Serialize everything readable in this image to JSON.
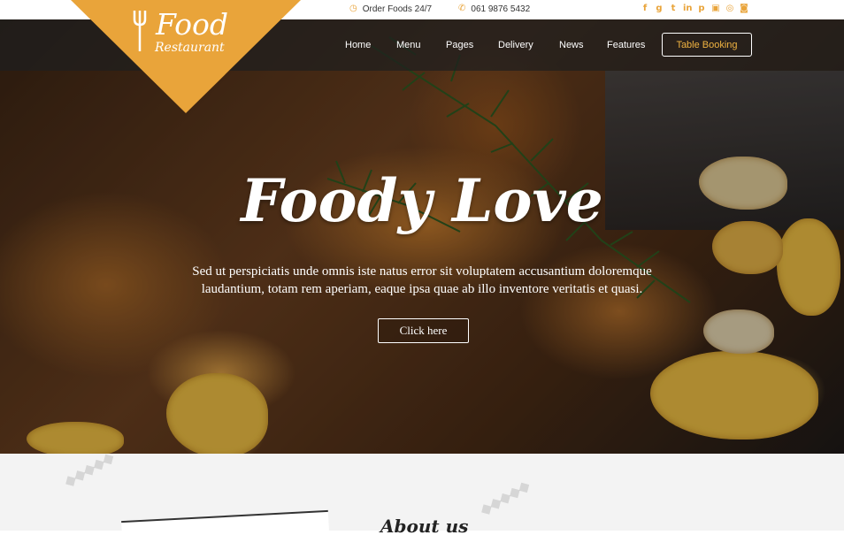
{
  "topbar": {
    "order_text": "Order Foods 24/7",
    "phone_text": "061 9876 5432",
    "social_icons": [
      "facebook-icon",
      "google-plus-icon",
      "twitter-icon",
      "linkedin-icon",
      "pinterest-icon",
      "youtube-icon",
      "whatsapp-icon",
      "instagram-icon"
    ]
  },
  "logo": {
    "line1": "Food",
    "line2": "Restaurant"
  },
  "nav": {
    "items": [
      "Home",
      "Menu",
      "Pages",
      "Delivery",
      "News",
      "Features"
    ],
    "booking_label": "Table Booking"
  },
  "hero": {
    "title": "Foody Love",
    "subtitle": "Sed ut perspiciatis unde omnis iste natus error sit voluptatem accusantium doloremque laudantium, totam rem aperiam, eaque ipsa quae ab illo inventore veritatis et quasi.",
    "cta_label": "Click here"
  },
  "about": {
    "title": "About us"
  },
  "colors": {
    "accent": "#e9a43a",
    "nav_bg": "#1e1e1e",
    "section_bg": "#f3f3f3"
  }
}
